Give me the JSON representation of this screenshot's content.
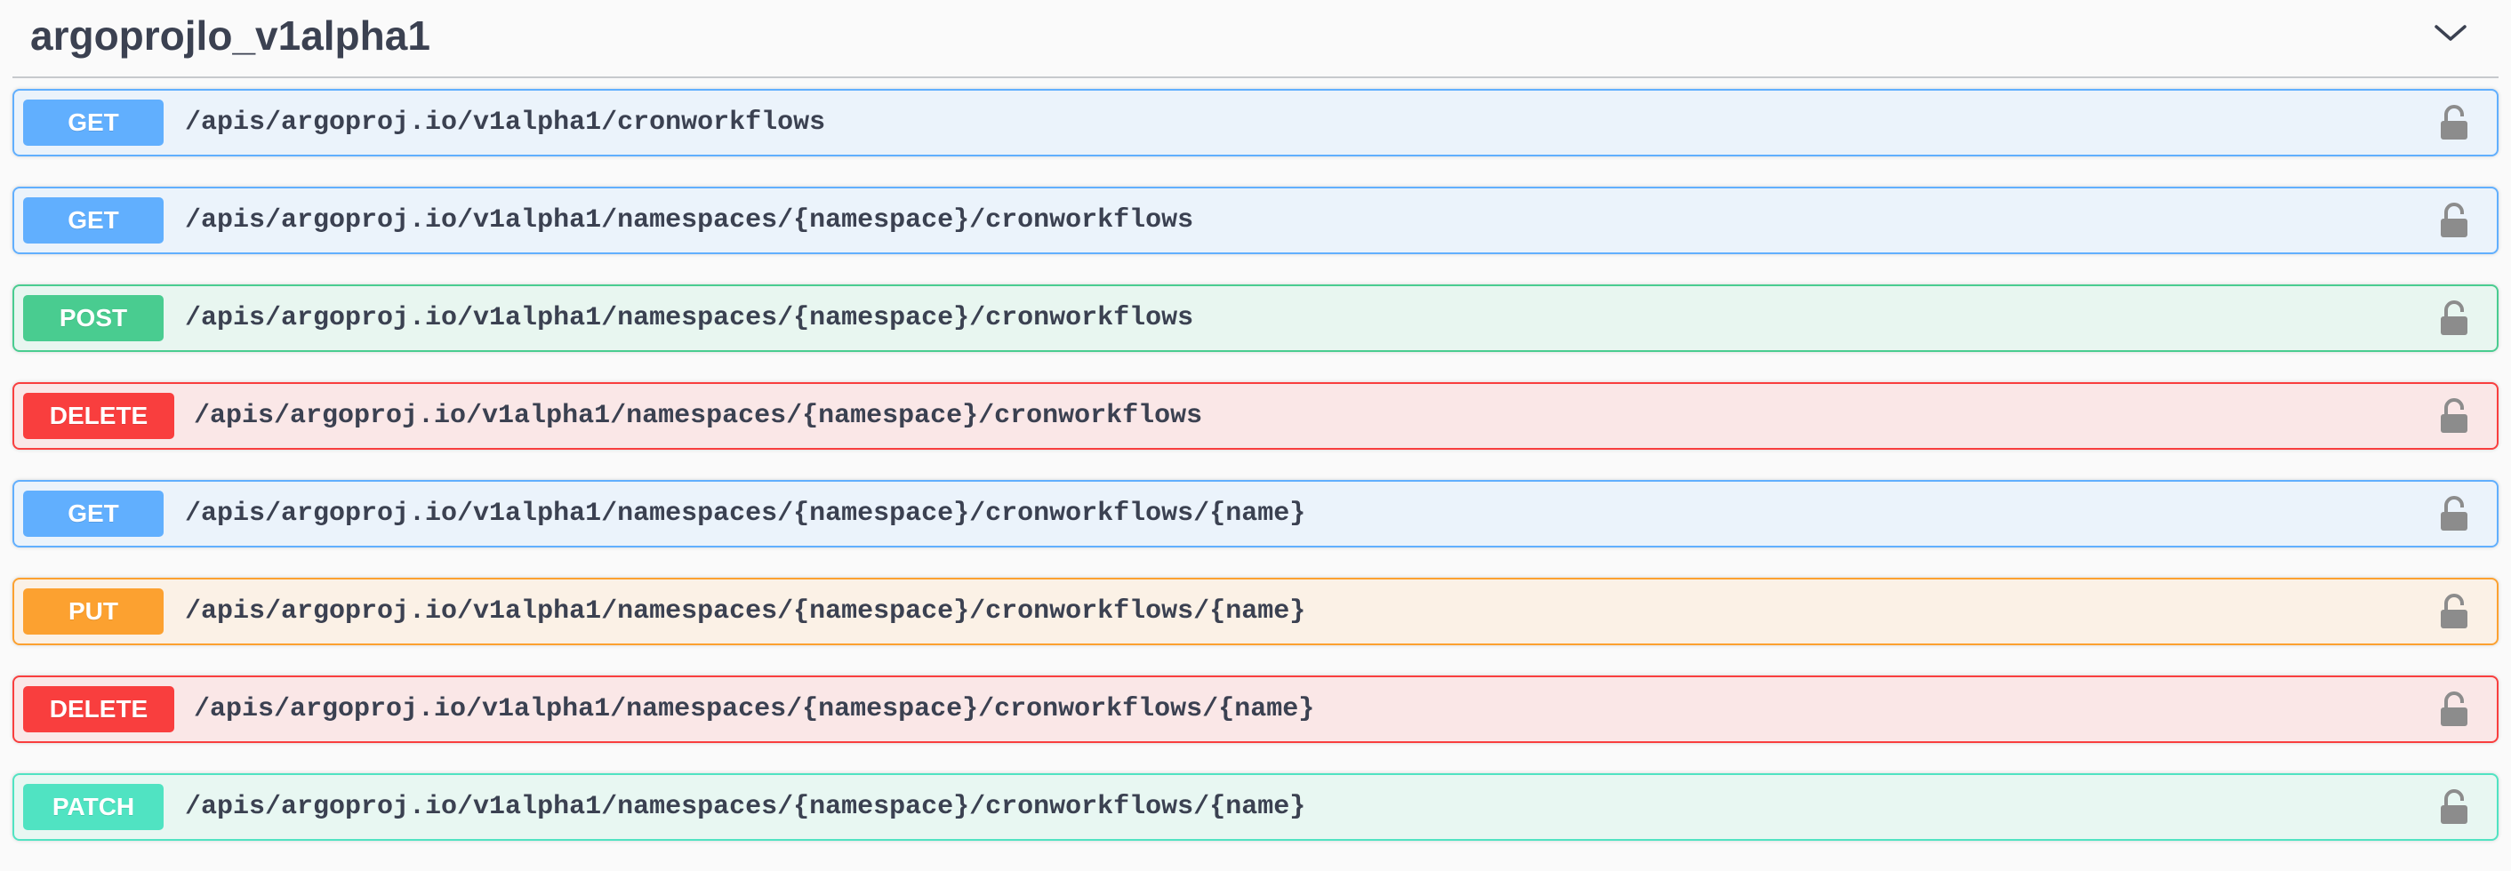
{
  "section": {
    "title": "argoprojlo_v1alpha1",
    "toggle_icon": "chevron-down-icon"
  },
  "operations": [
    {
      "method": "GET",
      "path": "/apis/argoproj.io/v1alpha1/cronworkflows",
      "locked": false
    },
    {
      "method": "GET",
      "path": "/apis/argoproj.io/v1alpha1/namespaces/{namespace}/cronworkflows",
      "locked": false
    },
    {
      "method": "POST",
      "path": "/apis/argoproj.io/v1alpha1/namespaces/{namespace}/cronworkflows",
      "locked": false
    },
    {
      "method": "DELETE",
      "path": "/apis/argoproj.io/v1alpha1/namespaces/{namespace}/cronworkflows",
      "locked": false
    },
    {
      "method": "GET",
      "path": "/apis/argoproj.io/v1alpha1/namespaces/{namespace}/cronworkflows/{name}",
      "locked": false
    },
    {
      "method": "PUT",
      "path": "/apis/argoproj.io/v1alpha1/namespaces/{namespace}/cronworkflows/{name}",
      "locked": false
    },
    {
      "method": "DELETE",
      "path": "/apis/argoproj.io/v1alpha1/namespaces/{namespace}/cronworkflows/{name}",
      "locked": false
    },
    {
      "method": "PATCH",
      "path": "/apis/argoproj.io/v1alpha1/namespaces/{namespace}/cronworkflows/{name}",
      "locked": false
    }
  ],
  "colors": {
    "get": "#61affe",
    "post": "#49cc90",
    "delete": "#f93e3e",
    "put": "#fca130",
    "patch": "#50e3c2",
    "text": "#3b4151",
    "lock": "#8c8c8c"
  }
}
